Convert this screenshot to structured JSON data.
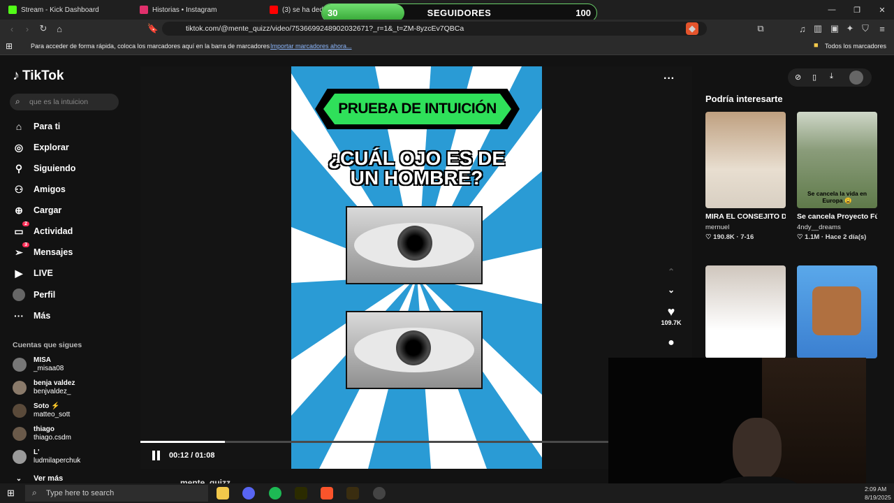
{
  "browser": {
    "tabs": [
      {
        "label": "Stream - Kick Dashboard",
        "color": "#53fc18"
      },
      {
        "label": "Historias • Instagram",
        "color": "#e1306c"
      },
      {
        "label": "(3) se ha dedi",
        "color": "#ff0000"
      }
    ],
    "url": "tiktok.com/@mente_quizz/video/7536699248902032671?_r=1&_t=ZM-8yzcEv7QBCa",
    "bookmarks_hint": "Para acceder de forma rápida, coloca los marcadores aquí en la barra de marcadores",
    "bookmarks_import": "Importar marcadores ahora...",
    "all_bookmarks": "Todos los marcadores"
  },
  "goal": {
    "current": "30",
    "label": "SEGUIDORES",
    "target": "100",
    "progress": 0.3
  },
  "tiktok": {
    "logo": "TikTok",
    "search_placeholder": "que es la intuicion",
    "nav": [
      {
        "label": "Para ti",
        "icon": "home-icon"
      },
      {
        "label": "Explorar",
        "icon": "compass-icon"
      },
      {
        "label": "Siguiendo",
        "icon": "following-icon"
      },
      {
        "label": "Amigos",
        "icon": "friends-icon"
      },
      {
        "label": "Cargar",
        "icon": "upload-icon"
      },
      {
        "label": "Actividad",
        "icon": "activity-icon",
        "badge": "2"
      },
      {
        "label": "Mensajes",
        "icon": "messages-icon",
        "badge": "3"
      },
      {
        "label": "LIVE",
        "icon": "live-icon"
      },
      {
        "label": "Perfil",
        "icon": "profile-icon"
      },
      {
        "label": "Más",
        "icon": "more-icon"
      }
    ],
    "following_title": "Cuentas que sigues",
    "following": [
      {
        "name": "MISA",
        "handle": "_misaa08"
      },
      {
        "name": "benja valdez",
        "handle": "benjvaldez_"
      },
      {
        "name": "Soto ⚡",
        "handle": "matteo_sott"
      },
      {
        "name": "thiago",
        "handle": "thiago.csdm"
      },
      {
        "name": "L'",
        "handle": "ludmilaperchuk"
      }
    ],
    "see_more": "Ver más"
  },
  "video": {
    "banner": "PRUEBA DE INTUICIÓN",
    "question_line1": "¿CUÁL OJO ES DE",
    "question_line2": "UN HOMBRE?",
    "time": "00:12 / 01:08",
    "progress": 0.18,
    "likes": "109.7K",
    "author": "mente_quizz"
  },
  "recommendations": {
    "title": "Podría interesarte",
    "cards": [
      {
        "title": "MIRA EL CONSEJITO DEL NUTRICIONIST...",
        "author": "mernuel",
        "meta": "♡ 190.8K · 7-16",
        "overlay": ""
      },
      {
        "title": "Se cancela Proyecto Fútbol ⚽ 😣",
        "author": "4ndy__dreams",
        "meta": "♡ 1.1M · Hace 2 día(s)",
        "overlay": "Se cancela la vida en Europa 😩"
      }
    ]
  },
  "taskbar": {
    "search_placeholder": "Type here to search",
    "time": "2:09 AM",
    "date": "8/19/2025"
  }
}
